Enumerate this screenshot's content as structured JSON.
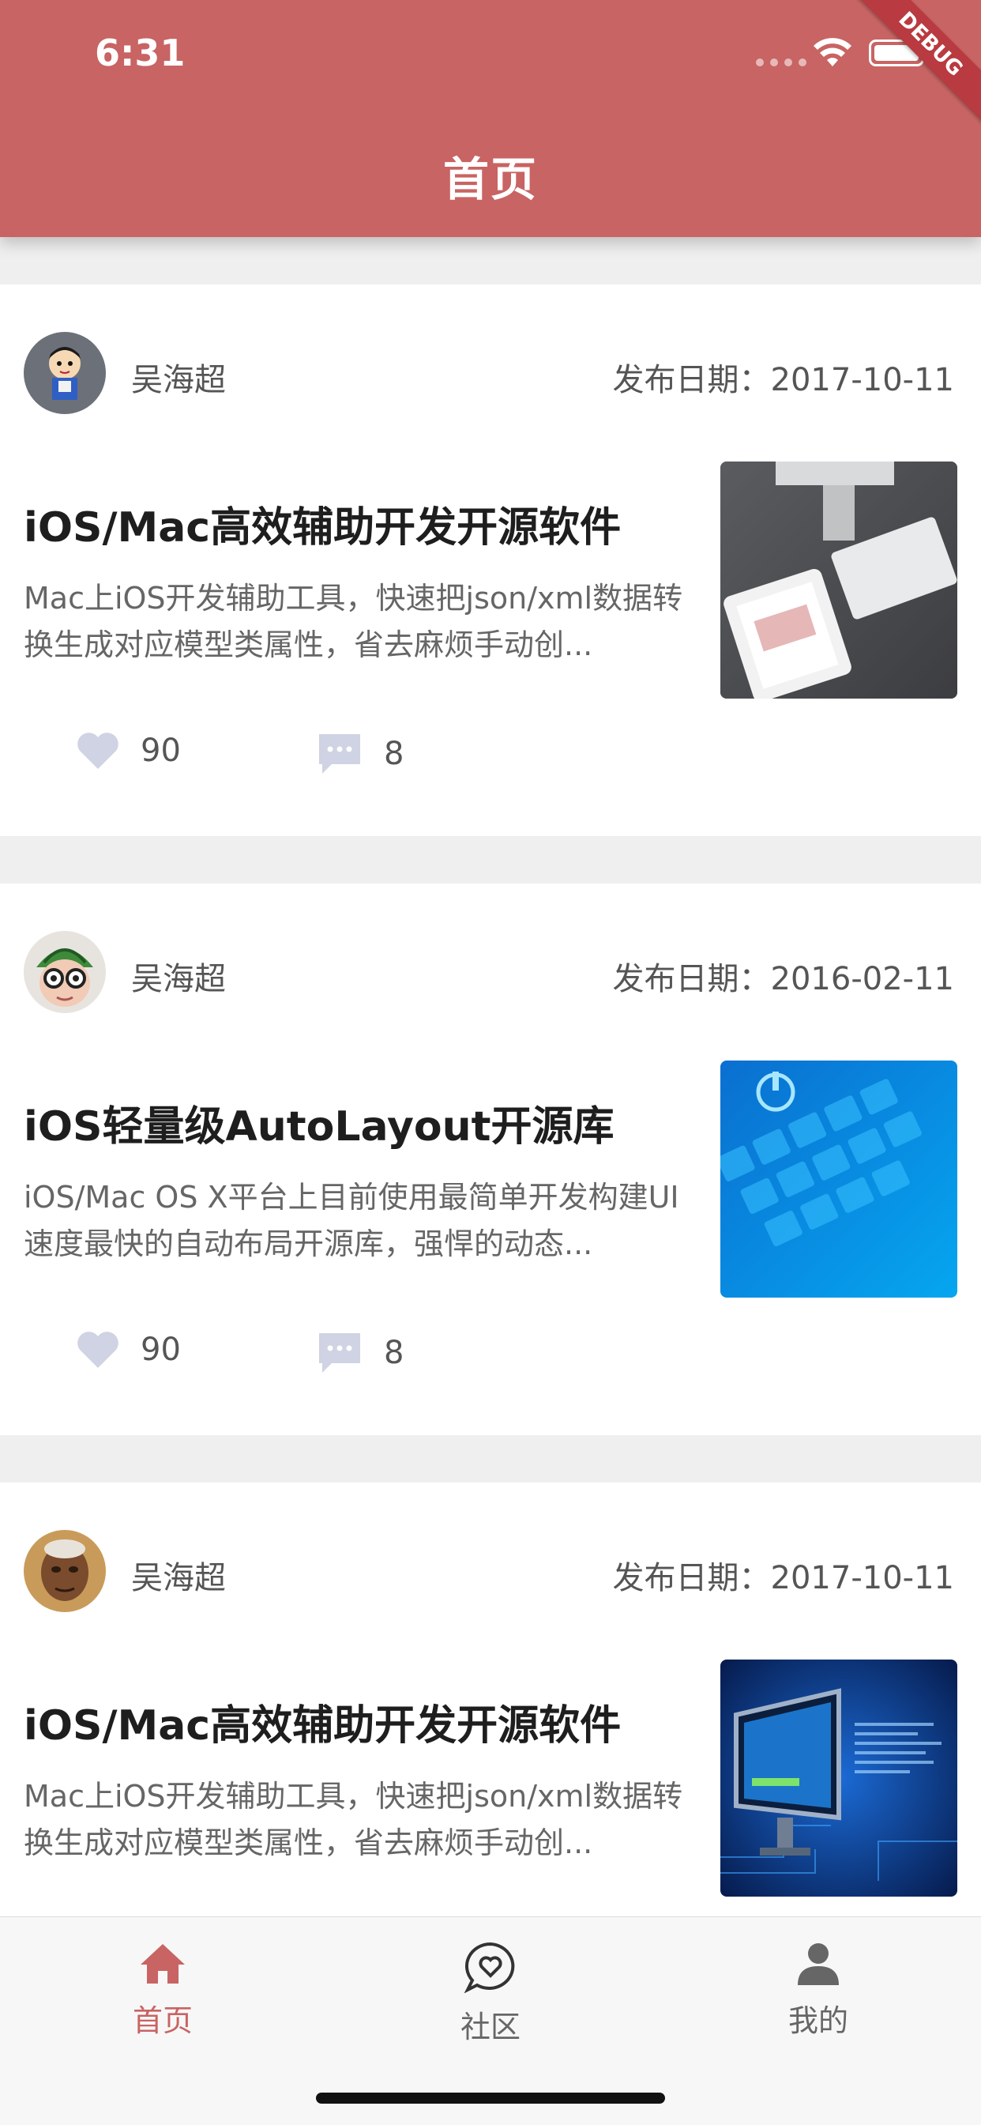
{
  "status_bar": {
    "time": "6:31",
    "debug_label": "DEBUG"
  },
  "header": {
    "title": "首页"
  },
  "colors": {
    "brand": "#c86463",
    "ribbon": "#b93a40",
    "icon_muted": "#cfd3e3"
  },
  "feed": [
    {
      "author": "吴海超",
      "date": "发布日期：2017-10-11",
      "title": "iOS/Mac高效辅助开发开源软件",
      "desc": "Mac上iOS开发辅助工具，快速把json/xml数据转换生成对应模型类属性，省去麻烦手动创...",
      "likes": "90",
      "comments": "8",
      "avatar_icon": "cartoon-avatar",
      "thumb_icon": "desk-tablet-image"
    },
    {
      "author": "吴海超",
      "date": "发布日期：2016-02-11",
      "title": "iOS轻量级AutoLayout开源库",
      "desc": "iOS/Mac OS X平台上目前使用最简单开发构建UI速度最快的自动布局开源库，强悍的动态...",
      "likes": "90",
      "comments": "8",
      "avatar_icon": "melon-avatar",
      "thumb_icon": "blue-keyboard-image"
    },
    {
      "author": "吴海超",
      "date": "发布日期：2017-10-11",
      "title": "iOS/Mac高效辅助开发开源软件",
      "desc": "Mac上iOS开发辅助工具，快速把json/xml数据转换生成对应模型类属性，省去麻烦手动创...",
      "likes": "",
      "comments": "",
      "avatar_icon": "portrait-avatar",
      "thumb_icon": "blue-monitor-image"
    }
  ],
  "tabbar": {
    "items": [
      {
        "label": "首页",
        "icon": "home-icon",
        "active": true
      },
      {
        "label": "社区",
        "icon": "community-icon",
        "active": false
      },
      {
        "label": "我的",
        "icon": "profile-icon",
        "active": false
      }
    ]
  }
}
